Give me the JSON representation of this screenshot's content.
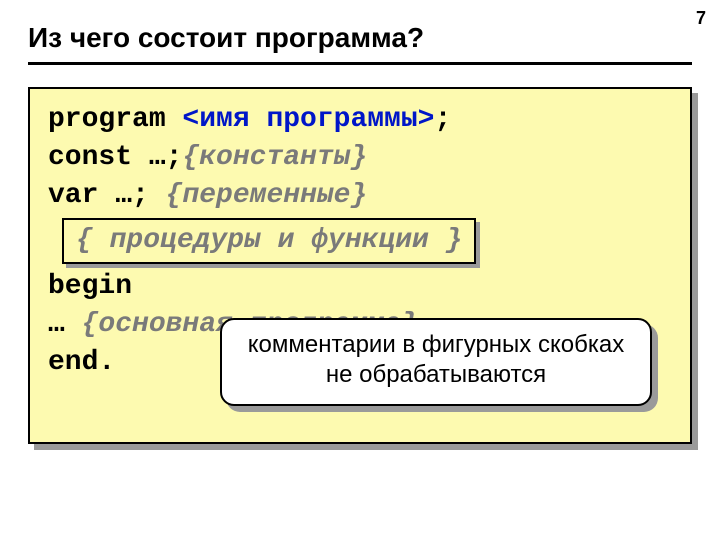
{
  "page_number": "7",
  "title": "Из чего состоит программа?",
  "code": {
    "l1_kw": "program",
    "l1_angle": " <имя программы>",
    "l1_tail": ";",
    "l2_kw": "const",
    "l2_plain": " …;",
    "l2_comment": "{константы}",
    "l3_kw": "var",
    "l3_plain": " …; ",
    "l3_comment": "{переменные}",
    "inner_open": "{ ",
    "inner_text": "процедуры и функции",
    "inner_close": " }",
    "l5_kw": "begin",
    "l6_plain": " … ",
    "l6_comment": "{основная программа}",
    "l7_kw": "end",
    "l7_tail": "."
  },
  "callout": {
    "line1": "комментарии в фигурных скобках",
    "line2": "не обрабатываются"
  }
}
